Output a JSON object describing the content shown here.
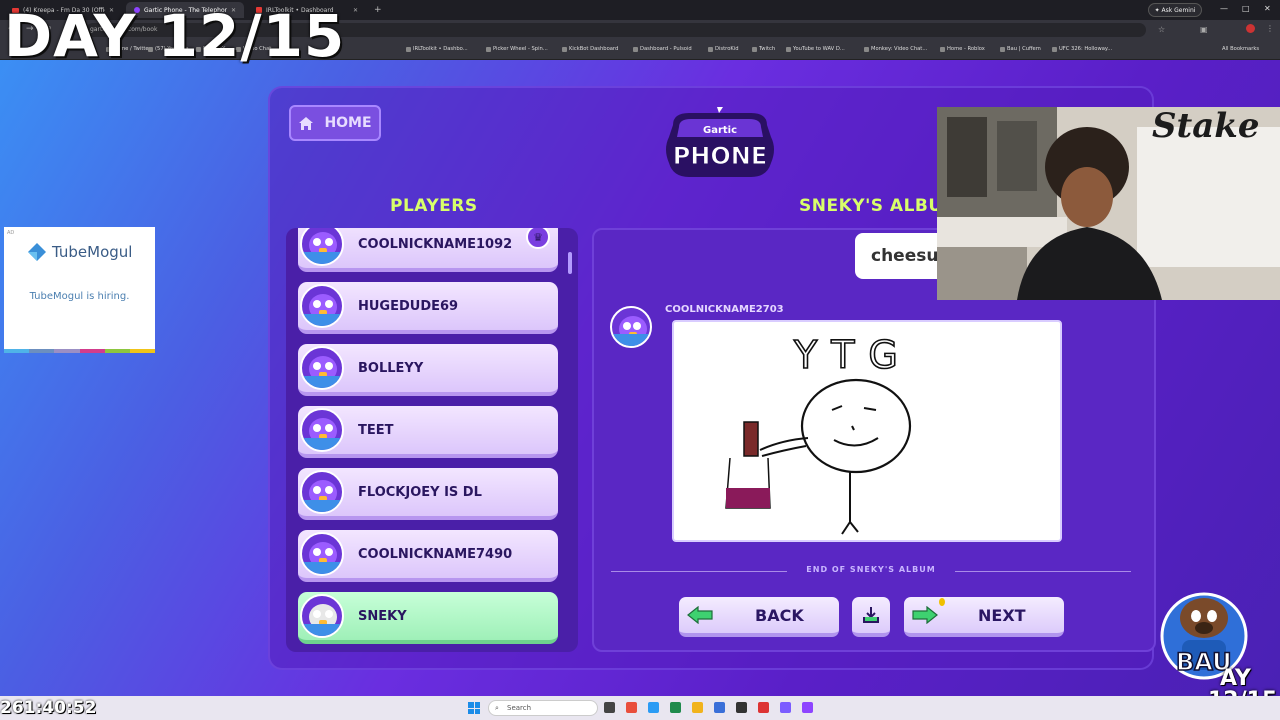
{
  "browser": {
    "tabs": [
      {
        "title": "(4) Kreepa - Fm Da 30 (Offici",
        "color": "#e53935"
      },
      {
        "title": "Gartic Phone - The Telephone G",
        "color": "#8e44ff"
      },
      {
        "title": "IRLToolkit • Dashboard",
        "color": "#e53935"
      }
    ],
    "new_tab": "+",
    "ask_gemini": "Ask Gemini",
    "url": "garticphone.com/book",
    "bookmarks": [
      "Home / Twitter",
      "(57) YouTube",
      "MONKEY",
      "Video Chat...",
      "IRLToolkit • Dashbo...",
      "Picker Wheel - Spin...",
      "KickBot Dashboard",
      "Dashboard - Pulsoid",
      "DistroKid",
      "Twitch",
      "YouTube to WAV D...",
      "Monkey: Video Chat...",
      "Home - Roblox",
      "Bau | Cuffem",
      "UFC 326: Holloway..."
    ],
    "all_bookmarks": "All Bookmarks"
  },
  "overlay": {
    "day_counter": "DAY 12/15",
    "timer": "261:40:52",
    "badge_text": "BAU",
    "badge_day_line1": "AY",
    "badge_day_line2": "12/15"
  },
  "ad": {
    "brand": "TubeMogul",
    "text": "TubeMogul is hiring.",
    "corner": "AD",
    "stripe_colors": [
      "#4fb3e8",
      "#6c8fbf",
      "#9b8fc4",
      "#d23c8c",
      "#8dc63f",
      "#f0c419"
    ]
  },
  "game": {
    "home_label": "HOME",
    "logo_line1": "Gartic",
    "logo_line2": "PHONE",
    "players_title": "PLAYERS",
    "album_title": "SNEKY'S ALBUM",
    "players": [
      {
        "name": "COOLNICKNAME1092",
        "host": true
      },
      {
        "name": "HUGEDUDE69"
      },
      {
        "name": "BOLLEYY"
      },
      {
        "name": "TEET"
      },
      {
        "name": "FLOCKJOEY IS DL"
      },
      {
        "name": "COOLNICKNAME7490"
      },
      {
        "name": "SNEKY",
        "current": true
      }
    ],
    "prompt_text": "cheesur",
    "drawing_author": "COOLNICKNAME2703",
    "drawing_text": "YTG",
    "end_label": "END OF SNEKY'S ALBUM",
    "back_label": "BACK",
    "next_label": "NEXT"
  },
  "taskbar": {
    "search": "Search"
  },
  "colors": {
    "accent_lime": "#d8ff6a",
    "row_purple": "#dcc6fb",
    "row_green": "#9ff0b8",
    "panel": "#5a27c4"
  }
}
